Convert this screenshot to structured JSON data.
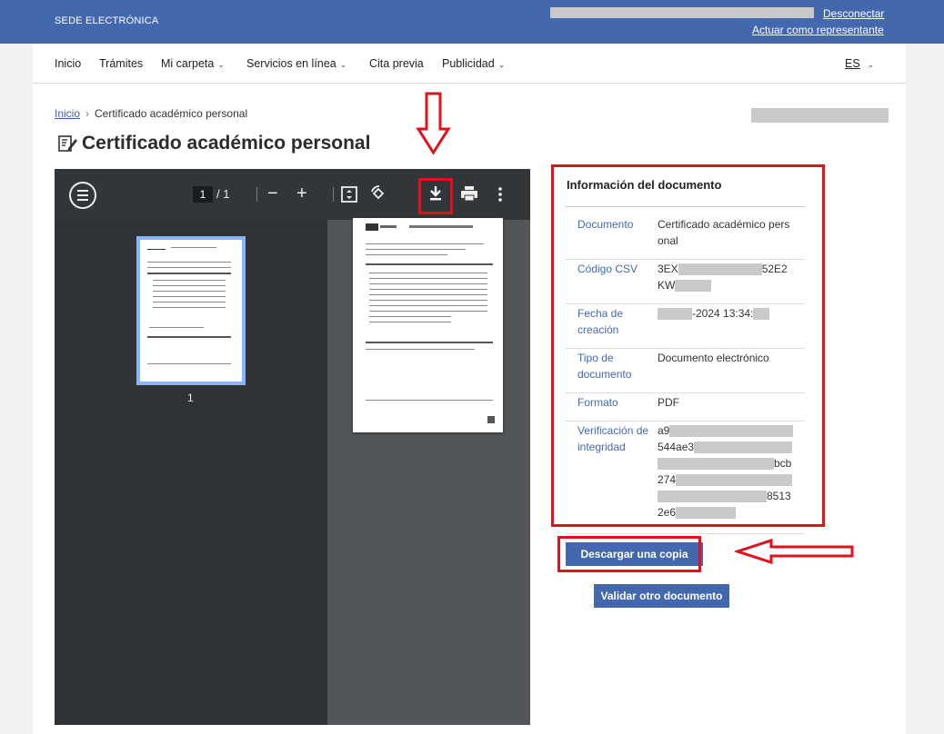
{
  "header": {
    "brand": "SEDE ELECTRÓNICA",
    "logout": "Desconectar",
    "represent": "Actuar como representante"
  },
  "nav": {
    "items": [
      "Inicio",
      "Trámites",
      "Mi carpeta",
      "Servicios en línea",
      "Cita previa",
      "Publicidad"
    ],
    "lang": "ES"
  },
  "breadcrumb": {
    "home": "Inicio",
    "current": "Certificado académico personal"
  },
  "page_title": "Certificado académico personal",
  "viewer": {
    "page": "1",
    "total": "/  1",
    "thumb_label": "1"
  },
  "info": {
    "heading": "Información del documento",
    "rows": [
      {
        "key": "Documento",
        "value": "Certificado académico pers onal"
      },
      {
        "key": "Código CSV",
        "value_a": "3EX",
        "value_b": "52E2",
        "value_c": "KW"
      },
      {
        "key": "Fecha de creación",
        "value": "-2024 13:34:"
      },
      {
        "key": "Tipo de documento",
        "value": "Documento electrónico"
      },
      {
        "key": "Formato",
        "value": "PDF"
      },
      {
        "key": "Verificación de integridad",
        "l1": "a9",
        "l2": "544ae3",
        "l3": "bcb",
        "l4": "274",
        "l5": "8513",
        "l6": "2e6"
      }
    ]
  },
  "buttons": {
    "copy": "Descargar una copia",
    "validate": "Validar otro documento"
  },
  "colors": {
    "brand_blue": "#4468ae",
    "annotation_red": "#e3101b"
  }
}
